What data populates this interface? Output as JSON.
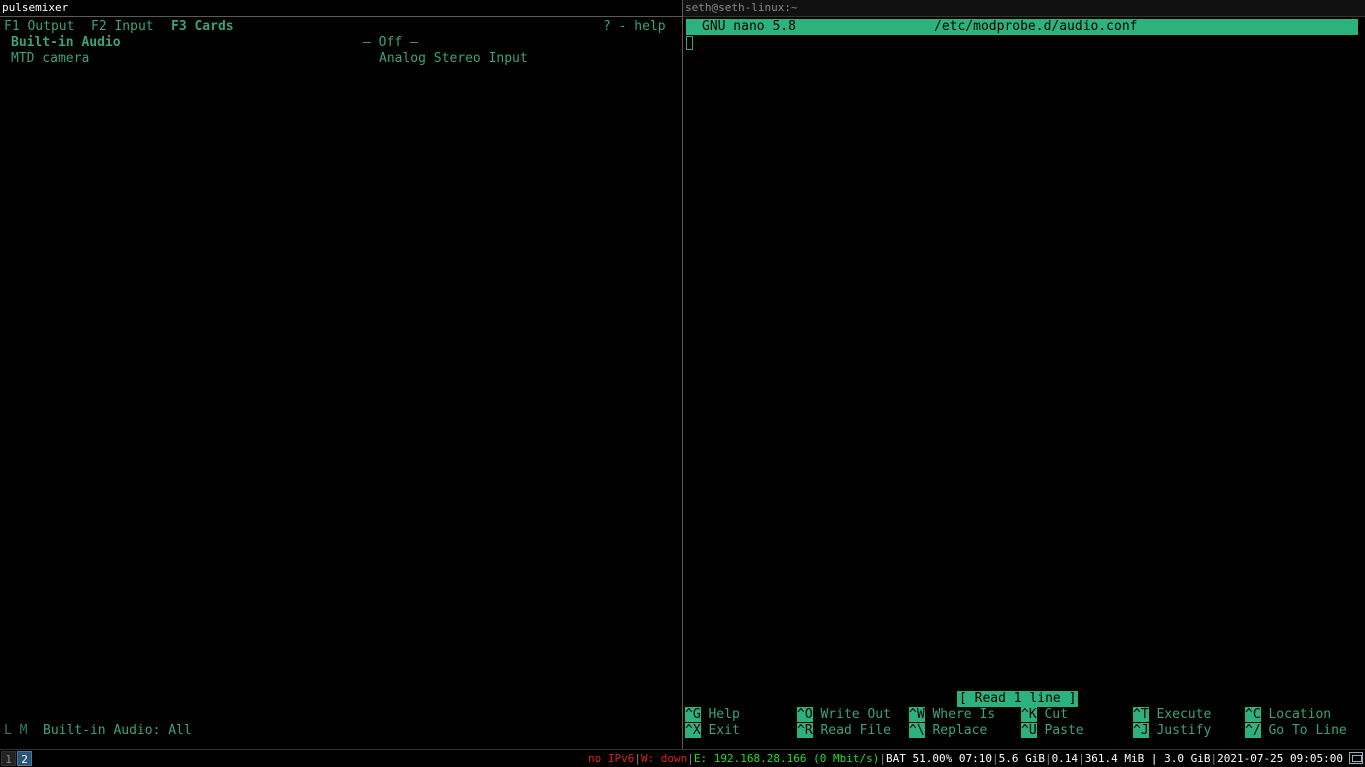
{
  "left_window": {
    "title": "pulsemixer",
    "tabs": [
      {
        "label": "F1 Output",
        "active": false
      },
      {
        "label": "F2 Input",
        "active": false
      },
      {
        "label": "F3 Cards",
        "active": true
      }
    ],
    "help_hint": "? - help",
    "cards": [
      {
        "name": "Built-in Audio",
        "profile": "— Off —",
        "selected": true
      },
      {
        "name": "MTD camera",
        "profile": "Analog Stereo Input",
        "selected": false
      }
    ],
    "footer": {
      "flags": "L M",
      "text": "Built-in Audio: All"
    }
  },
  "right_window": {
    "title": "seth@seth-linux:~",
    "nano": {
      "version": "GNU nano 5.8",
      "filename": "/etc/modprobe.d/audio.conf",
      "status": "[ Read 1 line ]",
      "shortcuts": [
        {
          "key": "^G",
          "label": "Help"
        },
        {
          "key": "^O",
          "label": "Write Out"
        },
        {
          "key": "^W",
          "label": "Where Is"
        },
        {
          "key": "^K",
          "label": "Cut"
        },
        {
          "key": "^T",
          "label": "Execute"
        },
        {
          "key": "^C",
          "label": "Location"
        },
        {
          "key": "^X",
          "label": "Exit"
        },
        {
          "key": "^R",
          "label": "Read File"
        },
        {
          "key": "^\\",
          "label": "Replace"
        },
        {
          "key": "^U",
          "label": "Paste"
        },
        {
          "key": "^J",
          "label": "Justify"
        },
        {
          "key": "^/",
          "label": "Go To Line"
        }
      ]
    }
  },
  "statusbar": {
    "workspaces": [
      "1",
      "2"
    ],
    "active_workspace": "2",
    "ipv6": "no IPv6",
    "wireless": "W: down",
    "ethernet": "E: 192.168.28.166 (0 Mbit/s)",
    "battery": "BAT 51.00% 07:10",
    "disk": "5.6 GiB",
    "load": "0.14",
    "memory": "361.4 MiB | 3.0 GiB",
    "datetime": "2021-07-25 09:05:00"
  }
}
